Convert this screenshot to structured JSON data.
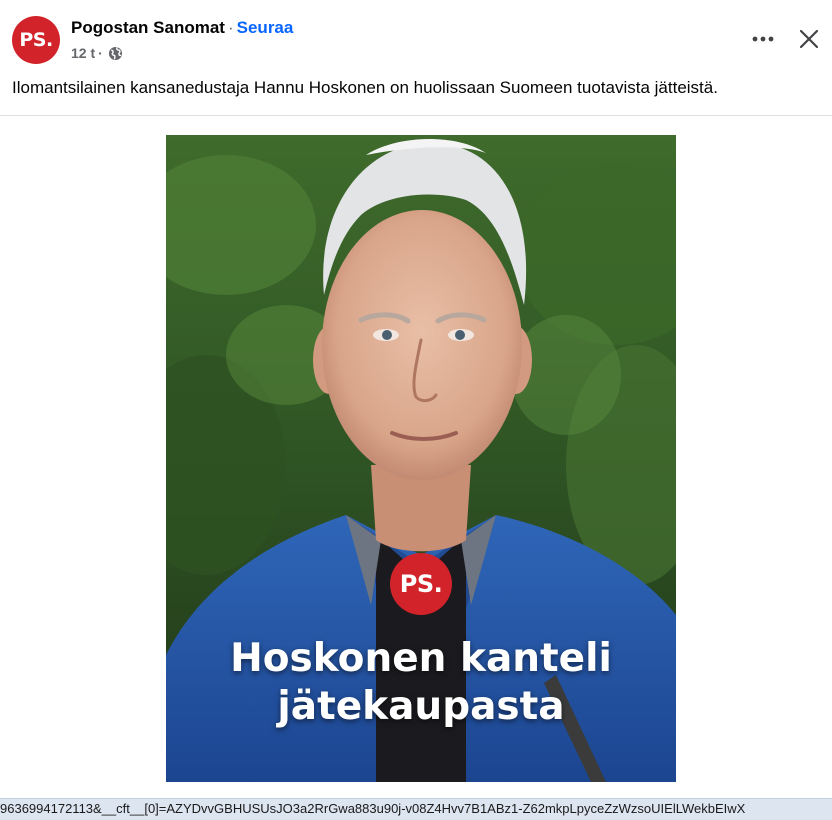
{
  "header": {
    "page_name": "Pogostan Sanomat",
    "separator": "·",
    "follow_label": "Seuraa",
    "time": "12 t",
    "meta_separator": "·",
    "avatar_text": "PS."
  },
  "post": {
    "text": "Ilomantsilainen kansanedustaja Hannu Hoskonen on huolissaan Suomeen tuotavista jätteistä."
  },
  "image": {
    "badge_text": "PS.",
    "headline_line1": "Hoskonen kanteli",
    "headline_line2": "jätekaupasta"
  },
  "status_bar": {
    "url": "9636994172113&__cft__[0]=AZYDvvGBHUSUsJO3a2RrGwa883u90j-v08Z4Hvv7B1ABz1-Z62mkpLpyceZzWzsoUIElLWekbEIwX"
  },
  "colors": {
    "brand_red": "#d2232a",
    "link_blue": "#0866ff",
    "meta_gray": "#65676b"
  },
  "icons": {
    "visibility": "globe-icon",
    "more": "more-horizontal-icon",
    "close": "close-icon"
  }
}
